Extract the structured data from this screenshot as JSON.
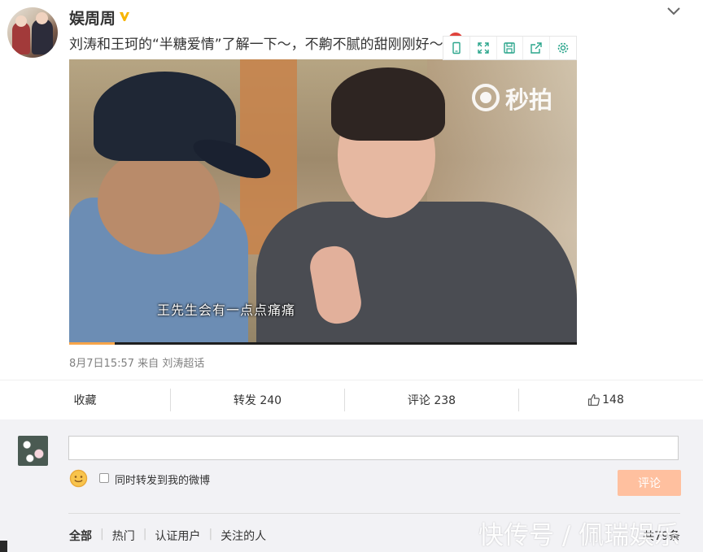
{
  "post": {
    "username": "娱周周",
    "verified_icon": "verified-v-icon",
    "text": "刘涛和王珂的“半糖爱情”了解一下～，不齁不腻的甜刚刚好～",
    "video": {
      "subtitle": "王先生会有一点点痛痛",
      "watermark": "秒拍",
      "progress": 0.09,
      "toolbar_icons": [
        "phone-icon",
        "expand-icon",
        "save-icon",
        "share-icon",
        "settings-icon"
      ]
    },
    "meta": {
      "time": "8月7日15:57",
      "from": "来自",
      "source": "刘涛超话"
    }
  },
  "actions": {
    "collect": "收藏",
    "repost": "转发 240",
    "comment": "评论 238",
    "like_count": "148"
  },
  "comment_box": {
    "input_value": "",
    "forward_label": "同时转发到我的微博",
    "submit_label": "评论"
  },
  "tabs": [
    "全部",
    "热门",
    "认证用户",
    "关注的人"
  ],
  "comment_count": "共79条",
  "watermark_bottom": "快传号 / 佩瑞娱乐",
  "colors": {
    "accent": "#f7a54a",
    "submit_bg": "#ffc09f",
    "verified": "#f7b500"
  }
}
